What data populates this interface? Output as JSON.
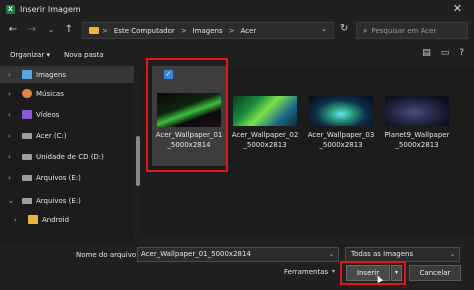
{
  "window": {
    "title": "Inserir Imagem",
    "app_icon_letter": "X",
    "close_glyph": "✕"
  },
  "nav": {
    "back": "←",
    "forward": "→",
    "dropdown": "⌄",
    "up": "↑",
    "breadcrumb": [
      "Este Computador",
      "Imagens",
      "Acer"
    ],
    "separator": ">",
    "refresh": "↻",
    "search_placeholder": "Pesquisar em Acer",
    "search_icon": "⌕"
  },
  "toolbar": {
    "organize": "Organizar ▾",
    "new_folder": "Nova pasta",
    "view_icon": "▤",
    "help_icon": "?"
  },
  "sidebar": {
    "items": [
      {
        "label": "Imagens",
        "icon": "images-icon",
        "color": "#5aa7e0",
        "selected": true
      },
      {
        "label": "Músicas",
        "icon": "music-icon",
        "color": "#e0844a",
        "selected": false
      },
      {
        "label": "Vídeos",
        "icon": "videos-icon",
        "color": "#8b5ad8",
        "selected": false
      },
      {
        "label": "Acer (C:)",
        "icon": "drive-icon",
        "color": "#9aa0a6",
        "selected": false
      },
      {
        "label": "Unidade de CD (D:)",
        "icon": "cd-drive-icon",
        "color": "#9aa0a6",
        "selected": false
      },
      {
        "label": "Arquivos (E:)",
        "icon": "drive-icon",
        "color": "#9aa0a6",
        "selected": false
      },
      {
        "label": "Arquivos (E:)",
        "icon": "drive-icon",
        "color": "#9aa0a6",
        "selected": false
      },
      {
        "label": "Android",
        "icon": "folder-icon",
        "color": "#e8b73b",
        "selected": false
      }
    ]
  },
  "files": [
    {
      "label": "Acer_Wallpaper_01_5000x2814",
      "selected": true
    },
    {
      "label": "Acer_Wallpaper_02_5000x2813",
      "selected": false
    },
    {
      "label": "Acer_Wallpaper_03_5000x2813",
      "selected": false
    },
    {
      "label": "Planet9_Wallpaper_5000x2813",
      "selected": false
    }
  ],
  "bottom": {
    "filename_label": "Nome do arquivo:",
    "filename_value": "Acer_Wallpaper_01_5000x2814",
    "filetype": "Todas as Imagens",
    "tools": "Ferramentas",
    "insert": "Inserir",
    "cancel": "Cancelar"
  },
  "colors": {
    "highlight": "#e3141a",
    "accent": "#3b84d6"
  }
}
